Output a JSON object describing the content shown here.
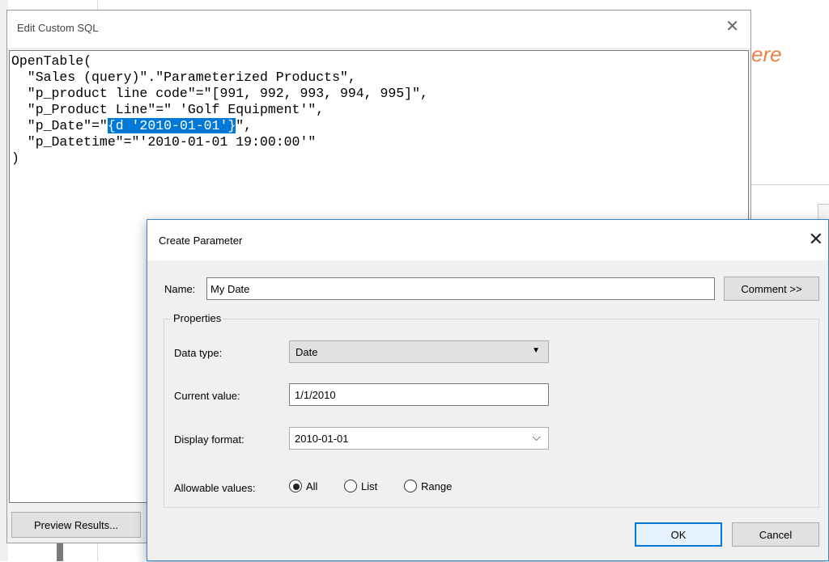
{
  "background": {
    "partial_text": "ere",
    "accent_color": "#e8824a"
  },
  "sql_window": {
    "title": "Edit Custom SQL",
    "close_icon": "close-icon",
    "lines": [
      "OpenTable(",
      "  \"Sales (query)\".\"Parameterized Products\",",
      "  \"p_product line code\"=\"[991, 992, 993, 994, 995]\",",
      "  \"p_Product Line\"=\" 'Golf Equipment'\",",
      "  \"p_Date\"=\"",
      "{d '2010-01-01'}",
      "\",",
      "  \"p_Datetime\"=\"'2010-01-01 19:00:00'\"",
      ")"
    ],
    "selection_color": "#0078d7",
    "preview_button": "Preview Results..."
  },
  "param_dialog": {
    "title": "Create Parameter",
    "close_icon": "close-icon",
    "name_label": "Name:",
    "name_value": "My Date",
    "comment_button": "Comment >>",
    "properties_legend": "Properties",
    "data_type_label": "Data type:",
    "data_type_value": "Date",
    "current_value_label": "Current value:",
    "current_value": "1/1/2010",
    "display_format_label": "Display format:",
    "display_format_value": "2010-01-01",
    "allowable_values_label": "Allowable values:",
    "allowable_options": [
      "All",
      "List",
      "Range"
    ],
    "allowable_selected": "All",
    "ok_button": "OK",
    "cancel_button": "Cancel",
    "focus_color": "#0078d7"
  }
}
